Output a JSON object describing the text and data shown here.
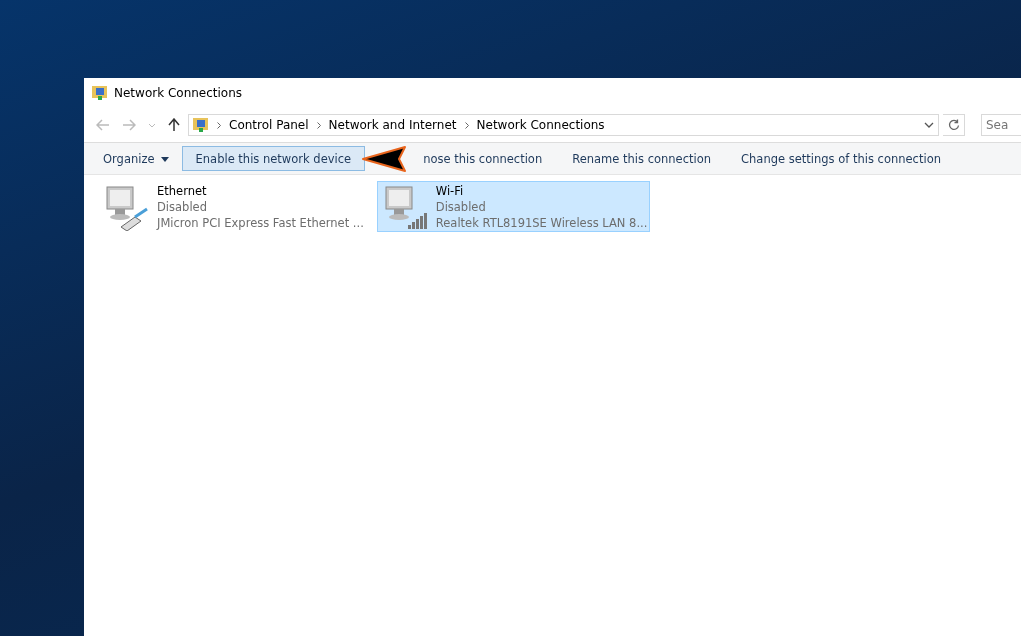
{
  "window": {
    "title": "Network Connections"
  },
  "address_bar": {
    "breadcrumbs": [
      "Control Panel",
      "Network and Internet",
      "Network Connections"
    ]
  },
  "search": {
    "placeholder": "Sea"
  },
  "toolbar": [
    {
      "label": "Organize",
      "kind": "menu",
      "selected": false
    },
    {
      "label": "Enable this network device",
      "kind": "button",
      "selected": true
    },
    {
      "label": "nose this connection",
      "kind": "button",
      "selected": false
    },
    {
      "label": "Rename this connection",
      "kind": "button",
      "selected": false
    },
    {
      "label": "Change settings of this connection",
      "kind": "button",
      "selected": false
    }
  ],
  "connections": [
    {
      "name": "Ethernet",
      "status": "Disabled",
      "adapter": "JMicron PCI Express Fast Ethernet ...",
      "kind": "ethernet",
      "selected": false
    },
    {
      "name": "Wi-Fi",
      "status": "Disabled",
      "adapter": "Realtek RTL8191SE Wireless LAN 8...",
      "kind": "wifi",
      "selected": true
    }
  ]
}
